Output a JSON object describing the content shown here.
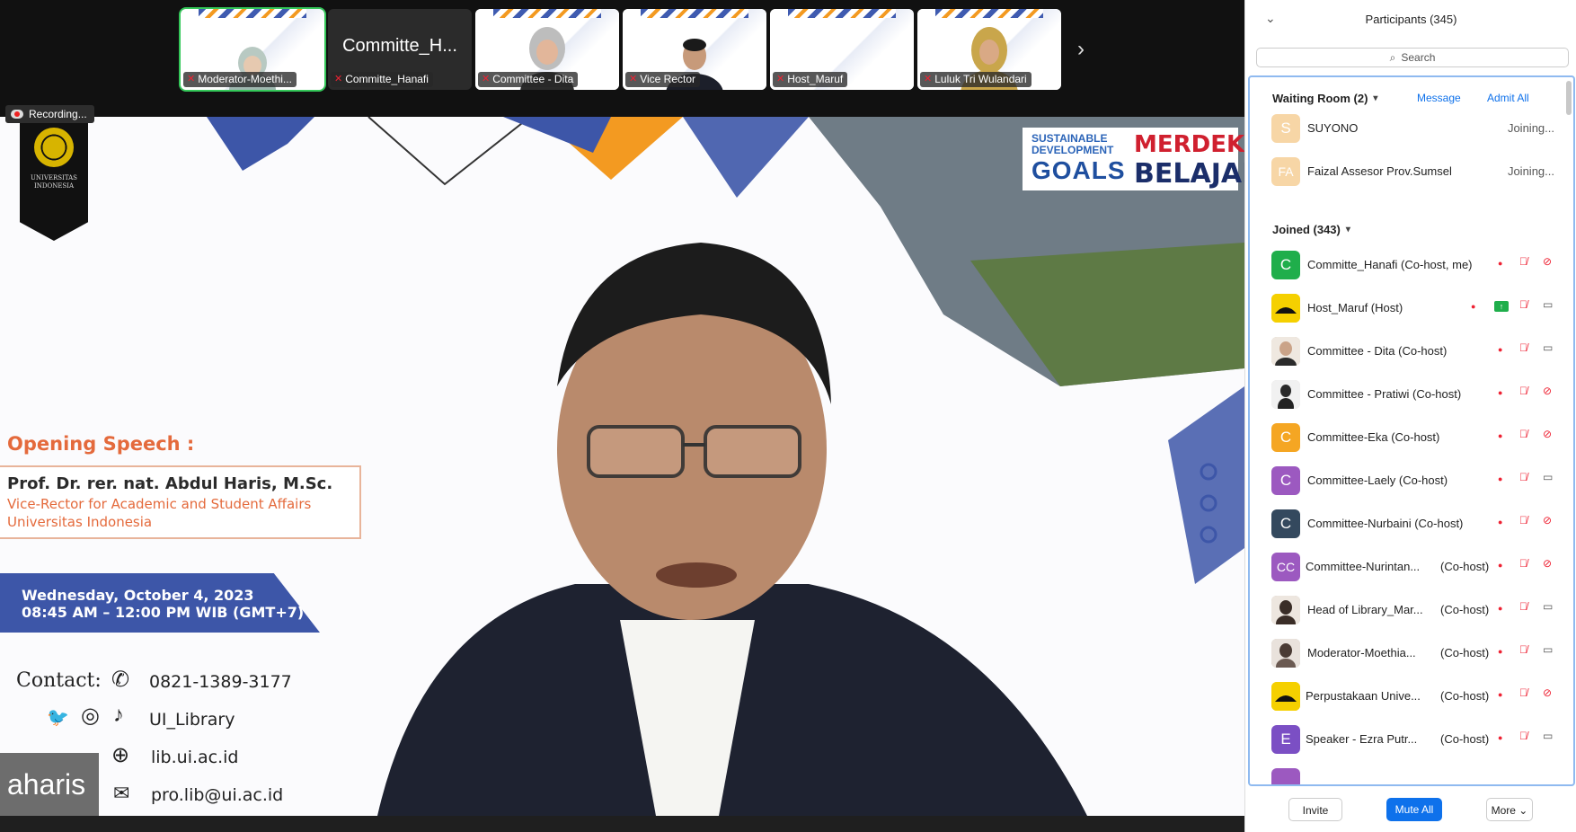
{
  "meeting": {
    "recording_label": "Recording...",
    "tiles": [
      {
        "name": "Moderator-Moethi..."
      },
      {
        "big": "Committe_H...",
        "name": "Committe_Hanafi"
      },
      {
        "name": "Committee - Dita"
      },
      {
        "name": "Vice Rector"
      },
      {
        "name": "Host_Maruf"
      },
      {
        "name": "Luluk Tri Wulandari"
      }
    ],
    "slide": {
      "logo_text": "UNIVERSITAS INDONESIA",
      "sdg_line1": "SUSTAINABLE",
      "sdg_line2": "DEVELOPMENT",
      "sdg_goals": "GOALS",
      "merdeka": "MERDEKA",
      "belajar": "BELAJAR",
      "speech_title": "Opening Speech :",
      "speaker_name": "Prof. Dr. rer. nat. Abdul Haris, M.Sc.",
      "speaker_role": "Vice-Rector for Academic and Student Affairs",
      "speaker_org": "Universitas Indonesia",
      "date_line1": "Wednesday, October 4, 2023",
      "date_line2": "08:45 AM – 12:00 PM WIB (GMT+7)",
      "contact_label": "Contact:",
      "phone": "0821-1389-3177",
      "social": "UI_Library",
      "website": "lib.ui.ac.id",
      "email": "pro.lib@ui.ac.id"
    },
    "speaker_label": "aharis"
  },
  "panel": {
    "title": "Participants (345)",
    "search_placeholder": "Search",
    "waiting_room": {
      "label": "Waiting Room (2)",
      "message_label": "Message",
      "admit_all_label": "Admit All",
      "people": [
        {
          "initials": "S",
          "name": "SUYONO",
          "status": "Joining...",
          "color": "#f7d6a6"
        },
        {
          "initials": "FA",
          "name": "Faizal Assesor Prov.Sumsel",
          "status": "Joining...",
          "color": "#f7d6a6"
        }
      ]
    },
    "joined": {
      "label": "Joined (343)",
      "people": [
        {
          "initials": "C",
          "name": "Committe_Hanafi (Co-host, me)",
          "role": "",
          "color": "#1fae4b",
          "video": "off"
        },
        {
          "initials": "",
          "name": "Host_Maruf (Host)",
          "role": "",
          "color": "#e9c400",
          "video": "on",
          "share": true
        },
        {
          "initials": "",
          "name": "Committee - Dita (Co-host)",
          "role": "",
          "color": "#c9b7a3",
          "video": "on"
        },
        {
          "initials": "",
          "name": "Committee - Pratiwi (Co-host)",
          "role": "",
          "color": "#d9d3ce",
          "video": "off"
        },
        {
          "initials": "C",
          "name": "Committee-Eka (Co-host)",
          "role": "",
          "color": "#f5a623",
          "video": "off"
        },
        {
          "initials": "C",
          "name": "Committee-Laely (Co-host)",
          "role": "",
          "color": "#9c59c0",
          "video": "on"
        },
        {
          "initials": "C",
          "name": "Committee-Nurbaini (Co-host)",
          "role": "",
          "color": "#34495e",
          "video": "off"
        },
        {
          "initials": "CC",
          "name": "Committee-Nurintan...",
          "role": "(Co-host)",
          "color": "#9c59c0",
          "video": "off"
        },
        {
          "initials": "",
          "name": "Head of Library_Mar...",
          "role": "(Co-host)",
          "color": "#b9a89a",
          "video": "on"
        },
        {
          "initials": "",
          "name": "Moderator-Moethia...",
          "role": "(Co-host)",
          "color": "#bfa99a",
          "video": "on"
        },
        {
          "initials": "",
          "name": "Perpustakaan Unive...",
          "role": "(Co-host)",
          "color": "#e9c400",
          "video": "off"
        },
        {
          "initials": "E",
          "name": "Speaker - Ezra Putr...",
          "role": "(Co-host)",
          "color": "#7b4fc4",
          "video": "on"
        }
      ]
    },
    "footer": {
      "invite": "Invite",
      "mute_all": "Mute All",
      "more": "More"
    },
    "colors": {
      "accent": "#0e71eb",
      "muted": "#e23333",
      "active_speaker": "#34c759"
    }
  }
}
